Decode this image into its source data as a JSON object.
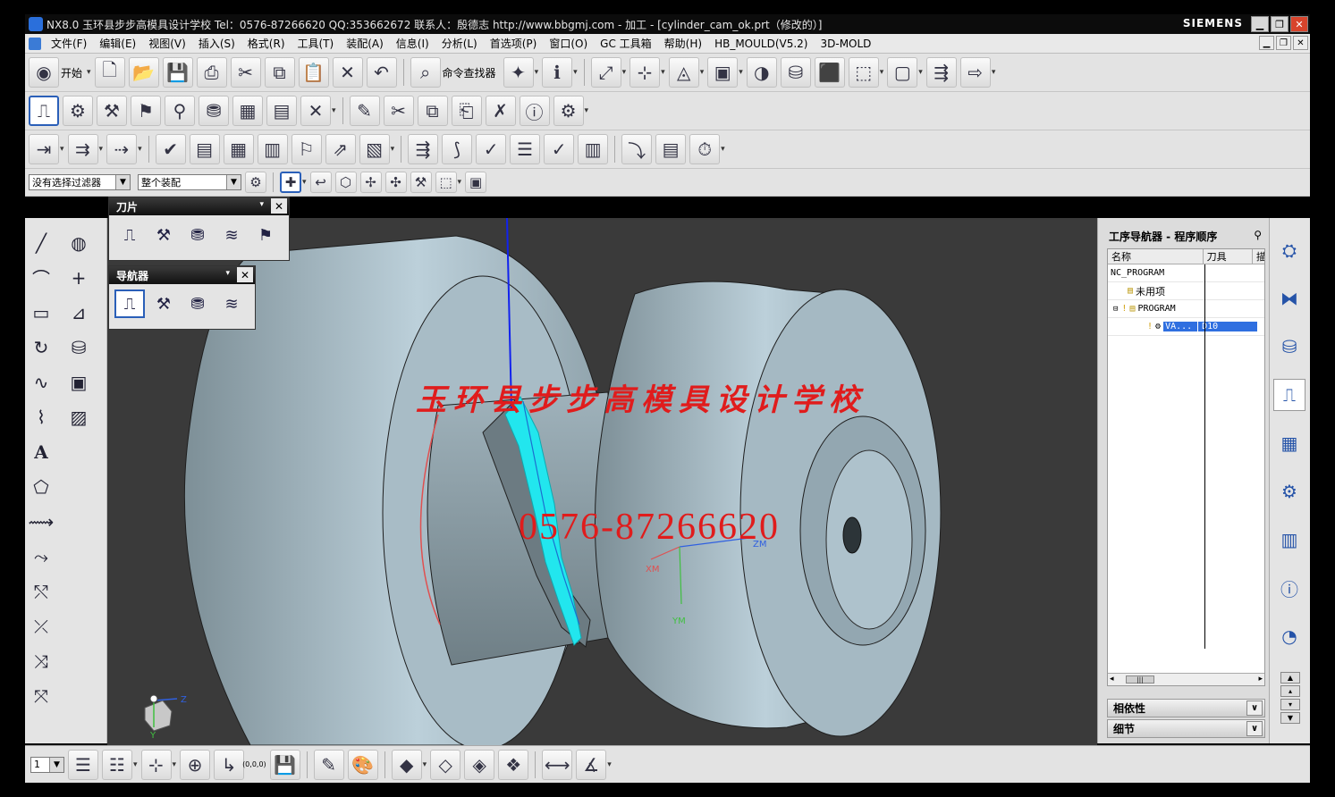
{
  "titlebar": {
    "title": "NX8.0 玉环县步步高模具设计学校  Tel：0576-87266620 QQ:353662672  联系人：殷德志  http://www.bbgmj.com - 加工 - [cylinder_cam_ok.prt（修改的）]",
    "brand": "SIEMENS",
    "min": "▁",
    "max": "❐",
    "close": "✕"
  },
  "menubar": {
    "items": [
      "文件(F)",
      "编辑(E)",
      "视图(V)",
      "插入(S)",
      "格式(R)",
      "工具(T)",
      "装配(A)",
      "信息(I)",
      "分析(L)",
      "首选项(P)",
      "窗口(O)",
      "GC 工具箱",
      "帮助(H)",
      "HB_MOULD(V5.2)",
      "3D-MOLD"
    ],
    "mdi_min": "▁",
    "mdi_max": "❐",
    "mdi_close": "✕"
  },
  "toolbar1": {
    "start_label": "开始",
    "command_finder_label": "命令查找器"
  },
  "selection_bar": {
    "filter_value": "没有选择过滤器",
    "scope_value": "整个装配"
  },
  "palettes": {
    "blade_title": "刀片",
    "navigator_title": "导航器"
  },
  "viewport": {
    "watermark_text": "玉环县步步高模具设计学校",
    "watermark_phone": "0576-87266620",
    "axis_xm": "XM",
    "axis_zm": "ZM",
    "axis_ym": "YM",
    "triad_z": "Z",
    "triad_y": "Y"
  },
  "operation_navigator": {
    "title": "工序导航器 - 程序顺序",
    "col_name": "名称",
    "col_tool": "刀具",
    "col_more": "描",
    "rows": [
      {
        "name": "NC_PROGRAM",
        "tool": ""
      },
      {
        "name": "未用项",
        "tool": ""
      },
      {
        "name": "PROGRAM",
        "tool": ""
      },
      {
        "name": "VA...",
        "tool": "D10"
      }
    ],
    "scroll_thumb": "|||",
    "dependencies": "相依性",
    "details": "细节"
  },
  "bottombar": {
    "layer_value": "1",
    "origin_label": "(0,0,0)"
  },
  "colors": {
    "accent": "#2f6fe0",
    "watermark": "#e01c1c",
    "toolpath": "#22e6ee",
    "model": "#a9bfc9",
    "viewport_bg": "#3a3a3a"
  },
  "icons": {
    "start": "start-icon",
    "new": "new-file-icon",
    "open": "open-folder-icon",
    "save": "save-icon",
    "print": "print-icon",
    "cut": "scissors-icon",
    "copy": "copy-icon",
    "paste": "paste-icon",
    "delete": "delete-icon",
    "undo": "undo-icon",
    "finder": "binoculars-icon"
  }
}
